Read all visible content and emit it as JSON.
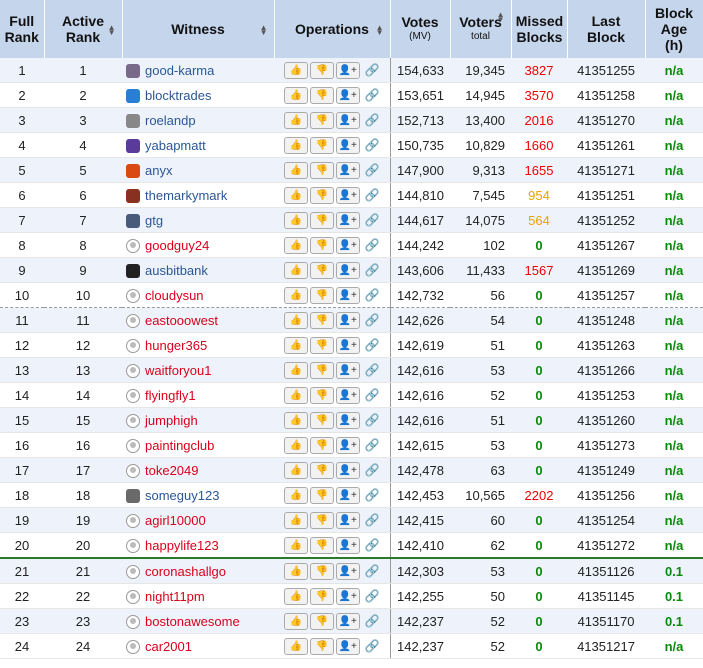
{
  "headers": {
    "full_rank": "Full Rank",
    "active_rank": "Active Rank",
    "witness": "Witness",
    "operations": "Operations",
    "votes": "Votes",
    "votes_sub": "(MV)",
    "voters": "Voters",
    "voters_sub": "total",
    "missed": "Missed Blocks",
    "last": "Last Block",
    "age": "Block Age (h)"
  },
  "colors": {
    "header_bg": "#c5d5ec",
    "missed_red": "#e00000",
    "missed_orange": "#f0a000",
    "ok_green": "#0a8a0a",
    "name_blue": "#2b5797",
    "name_red": "#d9001b"
  },
  "rows": [
    {
      "full": "1",
      "active": "1",
      "name": "good-karma",
      "name_color": "blue",
      "avatar": "#7a6a8a",
      "votes": "154,633",
      "voters": "19,345",
      "missed": "3827",
      "missed_color": "red",
      "last": "41351255",
      "age": "n/a"
    },
    {
      "full": "2",
      "active": "2",
      "name": "blocktrades",
      "name_color": "blue",
      "avatar": "#2a7fd4",
      "votes": "153,651",
      "voters": "14,945",
      "missed": "3570",
      "missed_color": "red",
      "last": "41351258",
      "age": "n/a"
    },
    {
      "full": "3",
      "active": "3",
      "name": "roelandp",
      "name_color": "blue",
      "avatar": "#888888",
      "votes": "152,713",
      "voters": "13,400",
      "missed": "2016",
      "missed_color": "red",
      "last": "41351270",
      "age": "n/a"
    },
    {
      "full": "4",
      "active": "4",
      "name": "yabapmatt",
      "name_color": "blue",
      "avatar": "#5a3a9a",
      "votes": "150,735",
      "voters": "10,829",
      "missed": "1660",
      "missed_color": "red",
      "last": "41351261",
      "age": "n/a"
    },
    {
      "full": "5",
      "active": "5",
      "name": "anyx",
      "name_color": "blue",
      "avatar": "#d84a10",
      "votes": "147,900",
      "voters": "9,313",
      "missed": "1655",
      "missed_color": "red",
      "last": "41351271",
      "age": "n/a"
    },
    {
      "full": "6",
      "active": "6",
      "name": "themarkymark",
      "name_color": "blue",
      "avatar": "#8a3020",
      "votes": "144,810",
      "voters": "7,545",
      "missed": "954",
      "missed_color": "orange",
      "last": "41351251",
      "age": "n/a"
    },
    {
      "full": "7",
      "active": "7",
      "name": "gtg",
      "name_color": "blue",
      "avatar": "#4a5a7a",
      "votes": "144,617",
      "voters": "14,075",
      "missed": "564",
      "missed_color": "orange",
      "last": "41351252",
      "age": "n/a"
    },
    {
      "full": "8",
      "active": "8",
      "name": "goodguy24",
      "name_color": "red",
      "avatar": "gray",
      "votes": "144,242",
      "voters": "102",
      "missed": "0",
      "missed_color": "green",
      "last": "41351267",
      "age": "n/a"
    },
    {
      "full": "9",
      "active": "9",
      "name": "ausbitbank",
      "name_color": "blue",
      "avatar": "#222222",
      "votes": "143,606",
      "voters": "11,433",
      "missed": "1567",
      "missed_color": "red",
      "last": "41351269",
      "age": "n/a"
    },
    {
      "full": "10",
      "active": "10",
      "name": "cloudysun",
      "name_color": "red",
      "avatar": "gray",
      "votes": "142,732",
      "voters": "56",
      "missed": "0",
      "missed_color": "green",
      "last": "41351257",
      "age": "n/a"
    },
    {
      "full": "11",
      "active": "11",
      "name": "eastooowest",
      "name_color": "red",
      "avatar": "gray",
      "votes": "142,626",
      "voters": "54",
      "missed": "0",
      "missed_color": "green",
      "last": "41351248",
      "age": "n/a"
    },
    {
      "full": "12",
      "active": "12",
      "name": "hunger365",
      "name_color": "red",
      "avatar": "gray",
      "votes": "142,619",
      "voters": "51",
      "missed": "0",
      "missed_color": "green",
      "last": "41351263",
      "age": "n/a"
    },
    {
      "full": "13",
      "active": "13",
      "name": "waitforyou1",
      "name_color": "red",
      "avatar": "gray",
      "votes": "142,616",
      "voters": "53",
      "missed": "0",
      "missed_color": "green",
      "last": "41351266",
      "age": "n/a"
    },
    {
      "full": "14",
      "active": "14",
      "name": "flyingfly1",
      "name_color": "red",
      "avatar": "gray",
      "votes": "142,616",
      "voters": "52",
      "missed": "0",
      "missed_color": "green",
      "last": "41351253",
      "age": "n/a"
    },
    {
      "full": "15",
      "active": "15",
      "name": "jumphigh",
      "name_color": "red",
      "avatar": "gray",
      "votes": "142,616",
      "voters": "51",
      "missed": "0",
      "missed_color": "green",
      "last": "41351260",
      "age": "n/a"
    },
    {
      "full": "16",
      "active": "16",
      "name": "paintingclub",
      "name_color": "red",
      "avatar": "gray",
      "votes": "142,615",
      "voters": "53",
      "missed": "0",
      "missed_color": "green",
      "last": "41351273",
      "age": "n/a"
    },
    {
      "full": "17",
      "active": "17",
      "name": "toke2049",
      "name_color": "red",
      "avatar": "gray",
      "votes": "142,478",
      "voters": "63",
      "missed": "0",
      "missed_color": "green",
      "last": "41351249",
      "age": "n/a"
    },
    {
      "full": "18",
      "active": "18",
      "name": "someguy123",
      "name_color": "blue",
      "avatar": "#6a6a6a",
      "votes": "142,453",
      "voters": "10,565",
      "missed": "2202",
      "missed_color": "red",
      "last": "41351256",
      "age": "n/a"
    },
    {
      "full": "19",
      "active": "19",
      "name": "agirl10000",
      "name_color": "red",
      "avatar": "gray",
      "votes": "142,415",
      "voters": "60",
      "missed": "0",
      "missed_color": "green",
      "last": "41351254",
      "age": "n/a"
    },
    {
      "full": "20",
      "active": "20",
      "name": "happylife123",
      "name_color": "red",
      "avatar": "gray",
      "votes": "142,410",
      "voters": "62",
      "missed": "0",
      "missed_color": "green",
      "last": "41351272",
      "age": "n/a"
    },
    {
      "full": "21",
      "active": "21",
      "name": "coronashallgo",
      "name_color": "red",
      "avatar": "gray",
      "votes": "142,303",
      "voters": "53",
      "missed": "0",
      "missed_color": "green",
      "last": "41351126",
      "age": "0.1"
    },
    {
      "full": "22",
      "active": "22",
      "name": "night11pm",
      "name_color": "red",
      "avatar": "gray",
      "votes": "142,255",
      "voters": "50",
      "missed": "0",
      "missed_color": "green",
      "last": "41351145",
      "age": "0.1"
    },
    {
      "full": "23",
      "active": "23",
      "name": "bostonawesome",
      "name_color": "red",
      "avatar": "gray",
      "votes": "142,237",
      "voters": "52",
      "missed": "0",
      "missed_color": "green",
      "last": "41351170",
      "age": "0.1"
    },
    {
      "full": "24",
      "active": "24",
      "name": "car2001",
      "name_color": "red",
      "avatar": "gray",
      "votes": "142,237",
      "voters": "52",
      "missed": "0",
      "missed_color": "green",
      "last": "41351217",
      "age": "n/a"
    }
  ]
}
